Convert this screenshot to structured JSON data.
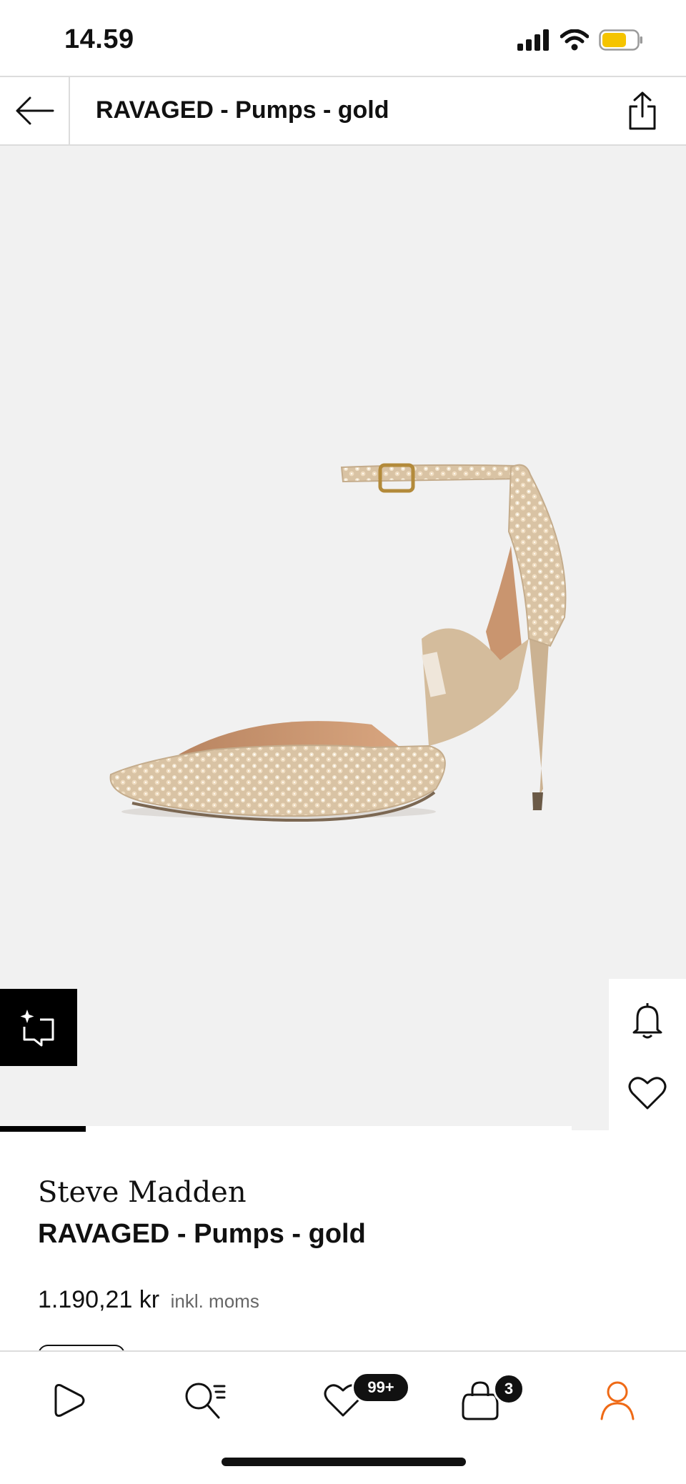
{
  "status_bar": {
    "time": "14.59",
    "icons": [
      "signal-icon",
      "wifi-icon",
      "battery-icon"
    ]
  },
  "header": {
    "title": "RAVAGED - Pumps - gold",
    "back_icon": "arrow-left-icon",
    "share_icon": "share-icon"
  },
  "gallery": {
    "image_progress": 0.15,
    "similar_icon": "find-similar-icon",
    "bell_icon": "bell-icon",
    "wishlist_icon": "heart-icon"
  },
  "product": {
    "brand": "Steve Madden",
    "name": "RAVAGED - Pumps - gold",
    "price": "1.190,21 kr",
    "vat_note": "inkl. moms"
  },
  "bottom_nav": {
    "items": [
      {
        "name": "home",
        "icon": "play-icon"
      },
      {
        "name": "search",
        "icon": "search-list-icon"
      },
      {
        "name": "wishlist",
        "icon": "heart-icon",
        "badge": "99+"
      },
      {
        "name": "bag",
        "icon": "bag-icon",
        "badge": "3"
      },
      {
        "name": "profile",
        "icon": "profile-icon",
        "color": "#ef6a16"
      }
    ]
  },
  "colors": {
    "accent": "#ef6a16",
    "battery": "#f5c400",
    "image_bg": "#f1f1f1"
  }
}
